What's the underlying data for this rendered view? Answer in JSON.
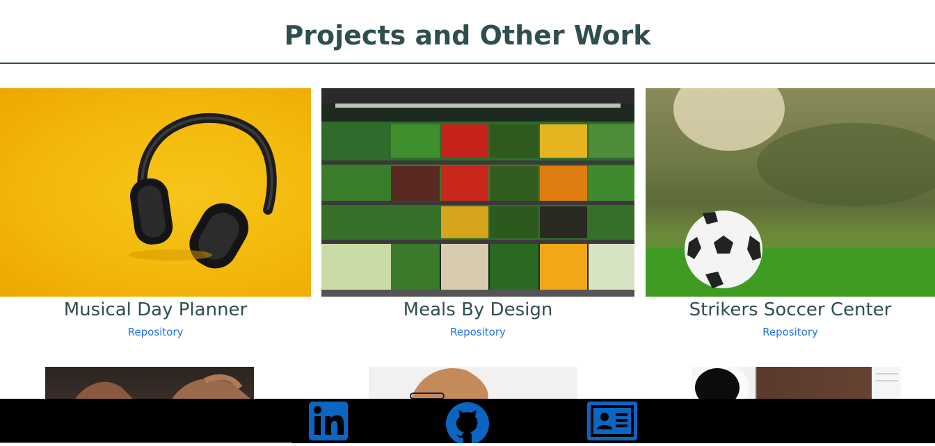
{
  "header": {
    "title": "Projects and Other Work"
  },
  "projects": [
    {
      "title": "Musical Day Planner",
      "link": "Repository",
      "image": "headphones-photo"
    },
    {
      "title": "Meals By Design",
      "link": "Repository",
      "image": "produce-shelves-photo"
    },
    {
      "title": "Strikers Soccer Center",
      "link": "Repository",
      "image": "soccer-ball-photo"
    }
  ],
  "more_projects": [
    {
      "image": "hands-photo"
    },
    {
      "image": "woman-with-glasses-photo"
    },
    {
      "image": "coffee-desk-photo"
    }
  ],
  "footer": {
    "icons": [
      "linkedin-icon",
      "github-icon",
      "contact-card-icon"
    ],
    "icon_color": "#0a66c2",
    "background": "#000000"
  },
  "colors": {
    "title": "#2f4f4f",
    "link": "#1e73e8"
  }
}
